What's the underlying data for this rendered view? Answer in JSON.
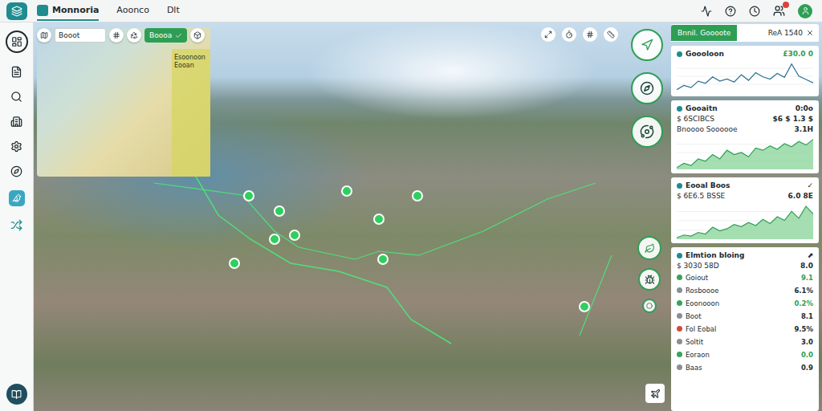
{
  "topbar": {
    "tabs": [
      {
        "label": "Monnoria",
        "selected": true
      },
      {
        "label": "Aoonco",
        "selected": false
      },
      {
        "label": "Dlt",
        "selected": false
      }
    ],
    "has_notification": true
  },
  "map_toolbar": {
    "search": "Booot",
    "chip": "Boooa",
    "chip_selected": true,
    "overlay_label": "Esoonoon Eooan"
  },
  "panel": {
    "tab": "Bnnil. Goooote",
    "tab_side": "ReA 1540",
    "cards": [
      {
        "kind": "line",
        "title": "Goooloon",
        "value": "£30.0 0",
        "rows": [],
        "chart": [
          3,
          4,
          3.5,
          5,
          4.5,
          6,
          5,
          5.5,
          4.8,
          6.5,
          5.2,
          7,
          6,
          5.5,
          6.8,
          5.9,
          9,
          6.2,
          5.4,
          4.6
        ],
        "items": []
      },
      {
        "kind": "area",
        "title": "Gooaitn",
        "value": "0:0o",
        "rows": [
          {
            "label": "$ 6SCIBCS",
            "value": "$6 $ 1.3 $"
          },
          {
            "label": "Bnoooo Soooooe",
            "value": "3.1H"
          }
        ],
        "chart": [
          2,
          3,
          2.5,
          4,
          3.5,
          5,
          4,
          6,
          5,
          5.5,
          4.5,
          6.5,
          6,
          7,
          6.2,
          7.5,
          6.8,
          8,
          7.2,
          8.5
        ],
        "items": []
      },
      {
        "kind": "area",
        "title": "Eooal Boos",
        "value": "✓",
        "rows": [
          {
            "label": "$ 6E6.5 BSSE",
            "value": "6.0 8E"
          }
        ],
        "chart": [
          1.5,
          2,
          1.8,
          2.5,
          2.2,
          3.5,
          2.8,
          3.2,
          4,
          3.6,
          4.4,
          3.8,
          5,
          4.2,
          5.5,
          4.8,
          6.5,
          5.2,
          7.5,
          6
        ],
        "items": []
      },
      {
        "kind": "list",
        "title": "Elmtion bloing",
        "value": "⬈",
        "rows": [
          {
            "label": "$ 3030 58D",
            "value": "8.0"
          }
        ],
        "chart": [],
        "items": [
          {
            "label": "Goiout",
            "value": "9.1",
            "color": "#3aa35a"
          },
          {
            "label": "Rosboooe",
            "value": "6.1%",
            "color": "#8a8f94"
          },
          {
            "label": "Eoonooon",
            "value": "0.2%",
            "color": "#3aa35a"
          },
          {
            "label": "Boot",
            "value": "8.1",
            "color": "#8a8f94"
          },
          {
            "label": "Fol Eobal",
            "value": "9.5%",
            "color": "#d14b3c"
          },
          {
            "label": "Soltit",
            "value": "3.0",
            "color": "#8a8f94"
          },
          {
            "label": "Eoraon",
            "value": "0.0",
            "color": "#3aa35a"
          },
          {
            "label": "Baas",
            "value": "0.9",
            "color": "#8a8f94"
          }
        ]
      }
    ]
  }
}
